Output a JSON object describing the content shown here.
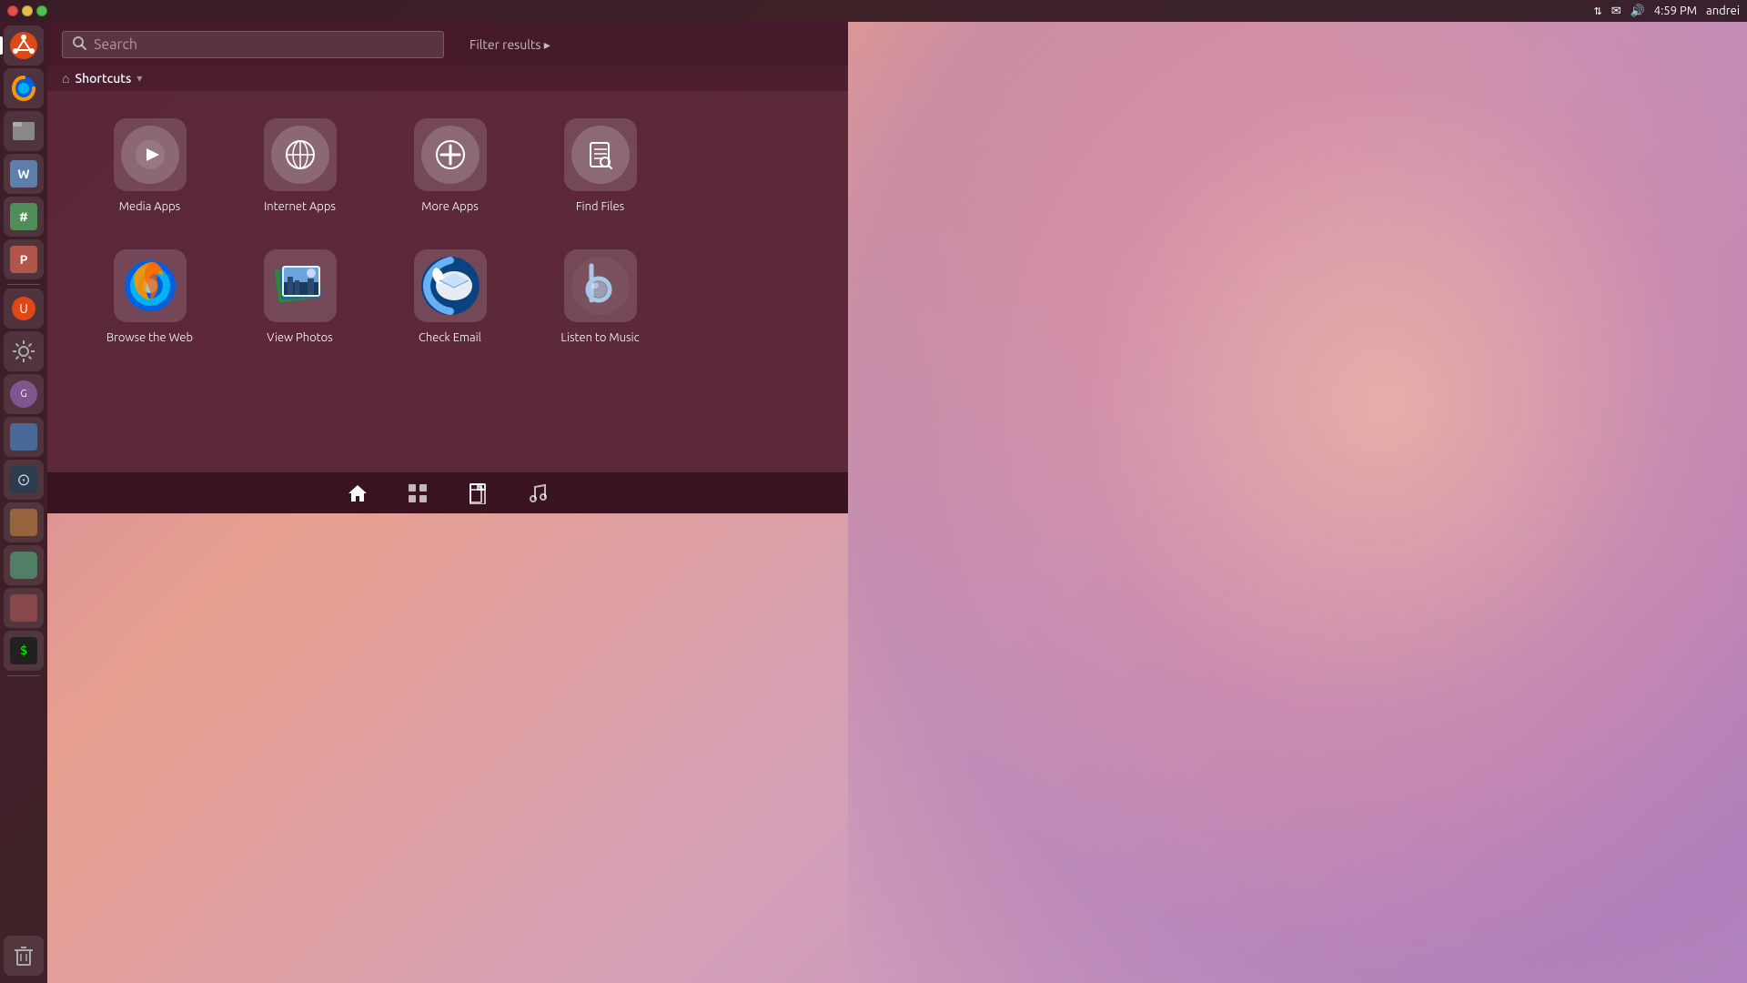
{
  "topPanel": {
    "time": "4:59 PM",
    "username": "andrei",
    "windowBtns": [
      "close",
      "minimize",
      "maximize"
    ]
  },
  "searchBar": {
    "placeholder": "Search",
    "filterLabel": "Filter results",
    "filterArrow": "▸"
  },
  "breadcrumb": {
    "homeIcon": "⌂",
    "label": "Shortcuts",
    "arrowIcon": "▾"
  },
  "shortcuts": {
    "row1": [
      {
        "id": "media-apps",
        "label": "Media Apps",
        "iconType": "lens-play"
      },
      {
        "id": "internet-apps",
        "label": "Internet Apps",
        "iconType": "lens-globe"
      },
      {
        "id": "more-apps",
        "label": "More Apps",
        "iconType": "lens-plus"
      },
      {
        "id": "find-files",
        "label": "Find Files",
        "iconType": "lens-file"
      }
    ],
    "row2": [
      {
        "id": "browse-web",
        "label": "Browse the Web",
        "iconType": "firefox"
      },
      {
        "id": "view-photos",
        "label": "View Photos",
        "iconType": "photos"
      },
      {
        "id": "check-email",
        "label": "Check Email",
        "iconType": "thunderbird"
      },
      {
        "id": "listen-music",
        "label": "Listen to Music",
        "iconType": "banshee"
      }
    ]
  },
  "categoryBar": {
    "items": [
      {
        "id": "home",
        "icon": "⌂",
        "active": true
      },
      {
        "id": "apps",
        "icon": "▦",
        "active": false
      },
      {
        "id": "files",
        "icon": "🗋",
        "active": false
      },
      {
        "id": "music",
        "icon": "♪",
        "active": false
      }
    ]
  },
  "launcher": {
    "items": [
      {
        "id": "ubuntu-logo",
        "type": "ubuntu"
      },
      {
        "id": "browser",
        "type": "app"
      },
      {
        "id": "email",
        "type": "app"
      },
      {
        "id": "files",
        "type": "app"
      },
      {
        "id": "office",
        "type": "app"
      },
      {
        "id": "office2",
        "type": "app"
      },
      {
        "id": "terminal",
        "type": "app"
      },
      {
        "id": "app7",
        "type": "app"
      },
      {
        "id": "app8",
        "type": "app"
      },
      {
        "id": "app9",
        "type": "app"
      },
      {
        "id": "app10",
        "type": "app"
      },
      {
        "id": "app11",
        "type": "app"
      },
      {
        "id": "app12",
        "type": "app"
      },
      {
        "id": "app13",
        "type": "app"
      },
      {
        "id": "app14",
        "type": "app"
      },
      {
        "id": "app15",
        "type": "app"
      }
    ]
  }
}
